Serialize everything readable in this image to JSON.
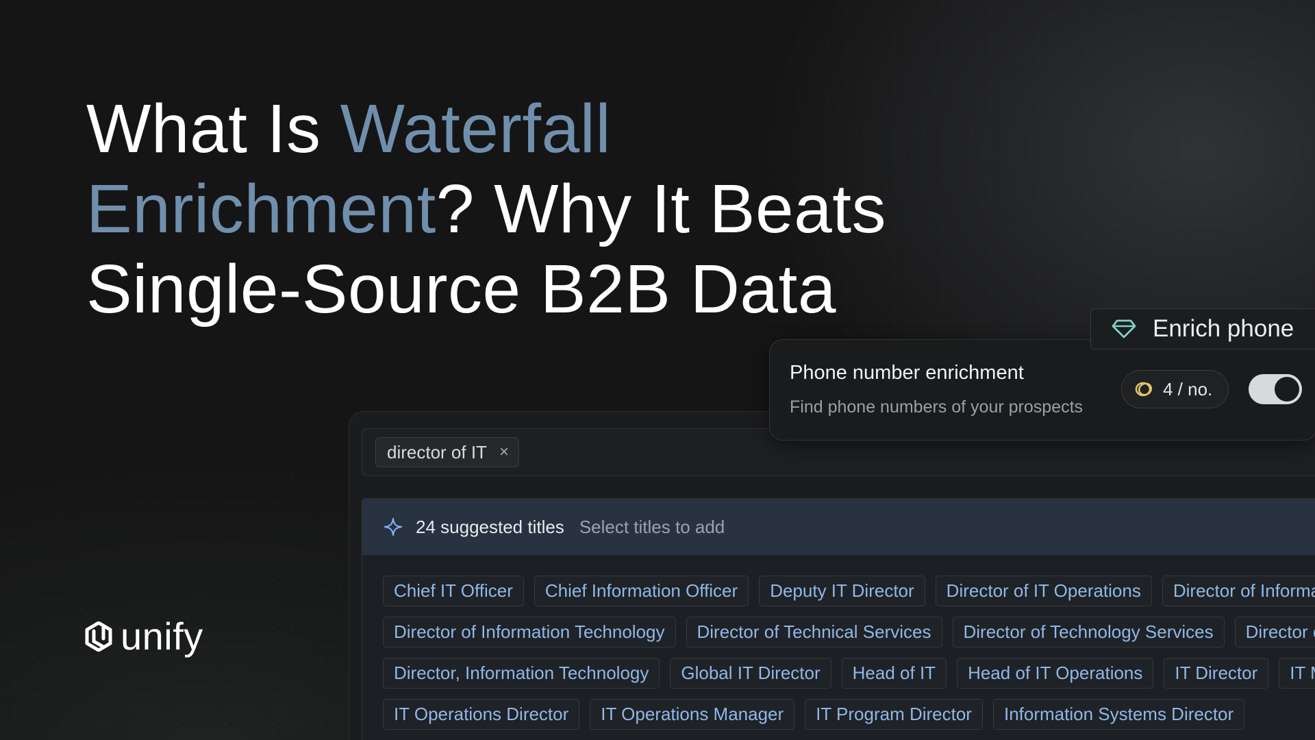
{
  "headline": {
    "part1": "What Is ",
    "accent1": "Waterfall",
    "accent2": "Enrichment",
    "part2": "? Why It Beats",
    "line3": "Single-Source B2B Data"
  },
  "brand": {
    "name": "unify",
    "icon": "unify-logo-icon"
  },
  "search": {
    "chip_label": "director of IT",
    "chip_remove": "×"
  },
  "suggestions": {
    "count_label": "24 suggested titles",
    "hint": "Select titles to add",
    "rows": [
      [
        "Chief IT Officer",
        "Chief Information Officer",
        "Deputy IT Director",
        "Director of IT Operations",
        "Director of Information Security"
      ],
      [
        "Director of Information Technology",
        "Director of Technical Services",
        "Director of Technology Services",
        "Director of IT Infrastructure"
      ],
      [
        "Director, Information Technology",
        "Global IT Director",
        "Head of IT",
        "Head of IT Operations",
        "IT Director",
        "IT Manager"
      ],
      [
        "IT Operations Director",
        "IT Operations Manager",
        "IT Program Director",
        "Information Systems Director"
      ]
    ]
  },
  "enrichment": {
    "pill_label": "Enrich phone",
    "title": "Phone number enrichment",
    "subtitle": "Find phone numbers of your prospects",
    "credits": "4 / no.",
    "toggle_on": true
  },
  "colors": {
    "accent_text": "#6f8fad",
    "tag_text": "#8fb8e8",
    "header_bg": "#283240",
    "coin": "#e3c46a",
    "gem": "#7fd1c8"
  }
}
